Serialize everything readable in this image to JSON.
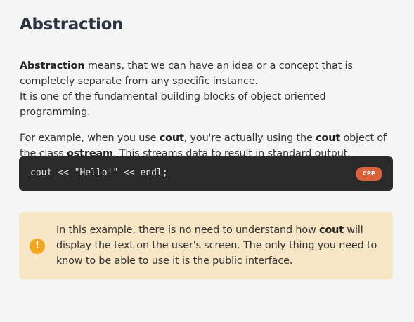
{
  "heading": "Abstraction",
  "paragraph1": {
    "bold_term": "Abstraction",
    "text_a": " means, that we can have an idea or a concept that is completely separate from any specific instance.",
    "text_b": "It is one of the fundamental building blocks of object oriented programming."
  },
  "paragraph2": {
    "part1": "For example, when you use ",
    "bold1": "cout",
    "part2": ", you're actually using the ",
    "bold2": "cout",
    "part3": " object of the class ",
    "bold3": "ostream",
    "part4": ". This streams data to result in standard output."
  },
  "code_block": {
    "code": "cout << \"Hello!\" << endl;",
    "language_badge": "CPP"
  },
  "note": {
    "icon": "!",
    "icon_name": "exclamation-icon",
    "part1": "In this example, there is no need to understand how ",
    "bold": "cout",
    "part2": " will display the text on the user's screen. The only thing you need to know to be able to use it is the public interface."
  },
  "colors": {
    "background": "#f5f5f5",
    "code_background": "#2a2a2a",
    "badge": "#d9623b",
    "note_background": "#f6e6c5",
    "note_icon": "#f0a821"
  }
}
